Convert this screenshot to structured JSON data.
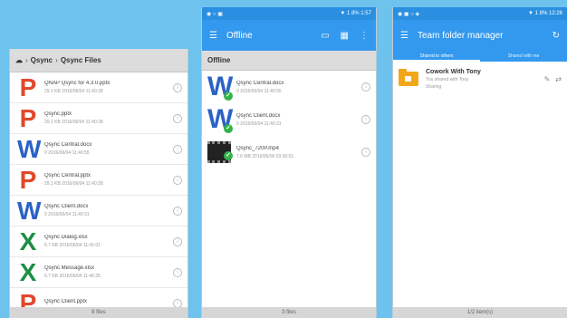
{
  "phone1": {
    "breadcrumb": [
      "Qsync",
      "Qsync Files"
    ],
    "files": [
      {
        "icon": "P",
        "type": "powerpoint",
        "name": "QNAP Qsync for 4.3.0.pptx",
        "meta": "29.1 KB  2016/06/04 11:40:28"
      },
      {
        "icon": "P",
        "type": "powerpoint",
        "name": "Qsync.pptx",
        "meta": "29.1 KB  2016/06/04 11:40:28"
      },
      {
        "icon": "W",
        "type": "word",
        "name": "Qsync Central.docx",
        "meta": "0  2016/06/04 11:40:55"
      },
      {
        "icon": "P",
        "type": "powerpoint",
        "name": "Qsync Central.pptx",
        "meta": "29.1 KB  2016/06/04 11:40:28"
      },
      {
        "icon": "W",
        "type": "word",
        "name": "Qsync Client.docx",
        "meta": "0  2016/06/04 11:40:31"
      },
      {
        "icon": "X",
        "type": "excel",
        "name": "Qsync Dialog.xlsx",
        "meta": "6.7 KB  2016/06/04 11:41:01"
      },
      {
        "icon": "X",
        "type": "excel",
        "name": "Qsync Message.xlsx",
        "meta": "6.7 KB  2016/06/04 11:40:35"
      },
      {
        "icon": "P",
        "type": "powerpoint",
        "name": "Qsync Client.pptx",
        "meta": ""
      }
    ],
    "footer": "8 files"
  },
  "phone2": {
    "status_left": "◉ ○ ▣",
    "status_right": "▼ 1 8% 1:57",
    "title": "Offline",
    "section": "Offline",
    "files": [
      {
        "icon": "W",
        "name": "Qsync Central.docx",
        "meta": "0  2016/06/04 11:40:55"
      },
      {
        "icon": "W",
        "name": "Qsync Client.docx",
        "meta": "0  2016/06/04 11:40:31"
      },
      {
        "icon": "video",
        "name": "Qsync_720P.mp4",
        "meta": "7.6 MB  2016/06/05 03:30:51"
      }
    ],
    "footer": "3 files"
  },
  "phone3": {
    "status_left": "◉ ▣ ○ ◈",
    "status_right": "▼ 1 8% 12:28",
    "title": "Team folder manager",
    "tabs": [
      "Shared to others",
      "Shared with me"
    ],
    "items": [
      {
        "name": "Cowork With Tony",
        "sub1": "You shared with Tony",
        "sub2": "Sharing"
      }
    ],
    "footer": "1/2 item(s)"
  },
  "colors": {
    "accent": "#3399ee",
    "background": "#6ec2ee",
    "powerpoint": "#e2482b",
    "word": "#2b62c4",
    "excel": "#1e8f45",
    "folder": "#f2a71b"
  }
}
